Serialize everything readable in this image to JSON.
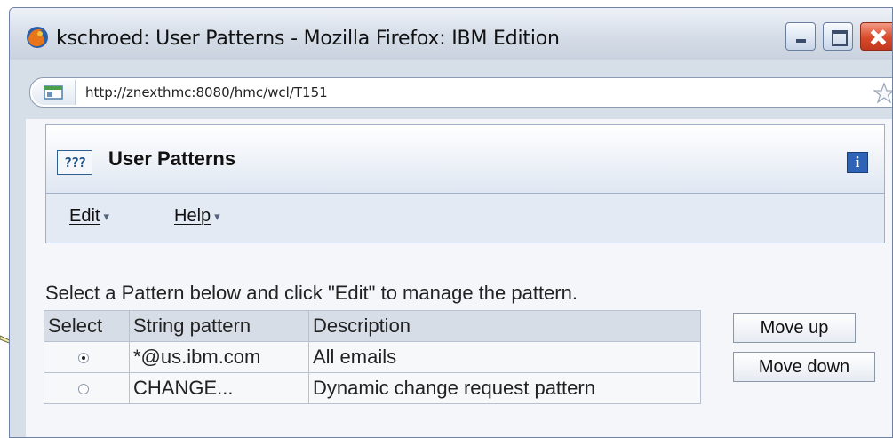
{
  "window": {
    "title": "kschroed: User Patterns - Mozilla Firefox: IBM Edition",
    "url": "http://znexthmc:8080/hmc/wcl/T151"
  },
  "app": {
    "icon_text": "???",
    "title": "User Patterns",
    "info_label": "i"
  },
  "menu": {
    "items": [
      {
        "label": "Edit",
        "caret": "▾"
      },
      {
        "label": "Help",
        "caret": "▾"
      }
    ]
  },
  "instruction": "Select a Pattern below and click \"Edit\" to manage the pattern.",
  "table": {
    "columns": [
      "Select",
      "String pattern",
      "Description"
    ],
    "rows": [
      {
        "selected": true,
        "string_pattern": "*@us.ibm.com",
        "description": "All emails"
      },
      {
        "selected": false,
        "string_pattern": "CHANGE...",
        "description": "Dynamic change request pattern"
      }
    ]
  },
  "buttons": {
    "move_up": "Move up",
    "move_down": "Move down"
  },
  "colors": {
    "title_bar": "#d3dbe6",
    "close_button": "#d84a2a",
    "info_icon": "#2f63b5"
  }
}
